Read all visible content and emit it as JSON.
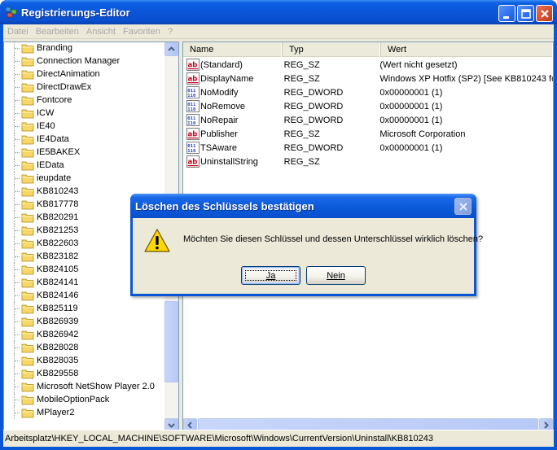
{
  "window": {
    "title": "Registrierungs-Editor"
  },
  "menu": {
    "items": [
      "Datei",
      "Bearbeiten",
      "Ansicht",
      "Favoriten",
      "?"
    ]
  },
  "tree": {
    "items": [
      "Branding",
      "Connection Manager",
      "DirectAnimation",
      "DirectDrawEx",
      "Fontcore",
      "ICW",
      "IE40",
      "IE4Data",
      "IE5BAKEX",
      "IEData",
      "ieupdate",
      "KB810243",
      "KB817778",
      "KB820291",
      "KB821253",
      "KB822603",
      "KB823182",
      "KB824105",
      "KB824141",
      "KB824146",
      "KB825119",
      "KB826939",
      "KB826942",
      "KB828028",
      "KB828035",
      "KB829558",
      "Microsoft NetShow Player 2.0",
      "MobileOptionPack",
      "MPlayer2"
    ]
  },
  "list": {
    "columns": [
      "Name",
      "Typ",
      "Wert"
    ],
    "rows": [
      {
        "icon": "string-value-icon",
        "name": "(Standard)",
        "type": "REG_SZ",
        "value": "(Wert nicht gesetzt)"
      },
      {
        "icon": "string-value-icon",
        "name": "DisplayName",
        "type": "REG_SZ",
        "value": "Windows XP Hotfix (SP2) [See KB810243 fo"
      },
      {
        "icon": "dword-value-icon",
        "name": "NoModify",
        "type": "REG_DWORD",
        "value": "0x00000001 (1)"
      },
      {
        "icon": "dword-value-icon",
        "name": "NoRemove",
        "type": "REG_DWORD",
        "value": "0x00000001 (1)"
      },
      {
        "icon": "dword-value-icon",
        "name": "NoRepair",
        "type": "REG_DWORD",
        "value": "0x00000001 (1)"
      },
      {
        "icon": "string-value-icon",
        "name": "Publisher",
        "type": "REG_SZ",
        "value": "Microsoft Corporation"
      },
      {
        "icon": "dword-value-icon",
        "name": "TSAware",
        "type": "REG_DWORD",
        "value": "0x00000001 (1)"
      },
      {
        "icon": "string-value-icon",
        "name": "UninstallString",
        "type": "REG_SZ",
        "value": ""
      }
    ]
  },
  "status": {
    "path": "Arbeitsplatz\\HKEY_LOCAL_MACHINE\\SOFTWARE\\Microsoft\\Windows\\CurrentVersion\\Uninstall\\KB810243"
  },
  "dialog": {
    "title": "Löschen des Schlüssels bestätigen",
    "message": "Möchten Sie diesen Schlüssel und dessen Unterschlüssel wirklich löschen?",
    "yes_label": "Ja",
    "no_label": "Nein"
  },
  "colors": {
    "title_bar": "#0a55d8",
    "face": "#ece9d8",
    "folder": "#f7d769"
  }
}
